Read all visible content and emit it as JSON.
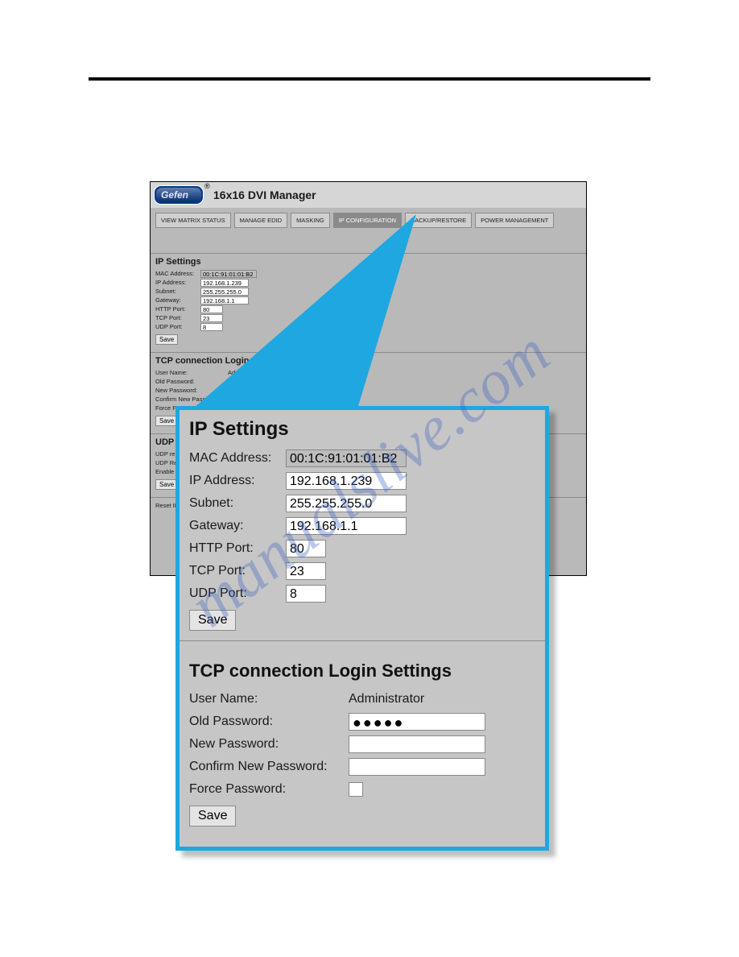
{
  "watermark": "manualslive.com",
  "shot": {
    "brand": "Gefen",
    "title": "16x16 DVI Manager",
    "tabs": [
      "VIEW MATRIX STATUS",
      "MANAGE EDID",
      "MASKING",
      "IP CONFIGURATION",
      "BACKUP/RESTORE",
      "POWER MANAGEMENT"
    ],
    "ip": {
      "heading": "IP Settings",
      "mac_lbl": "MAC Address:",
      "mac_val": "00:1C:91:01:01:B2",
      "ipaddr_lbl": "IP Address:",
      "ipaddr_val": "192.168.1.239",
      "subnet_lbl": "Subnet:",
      "subnet_val": "255.255.255.0",
      "gateway_lbl": "Gateway:",
      "gateway_val": "192.168.1.1",
      "http_lbl": "HTTP Port:",
      "http_val": "80",
      "tcp_lbl": "TCP Port:",
      "tcp_val": "23",
      "udp_lbl": "UDP Port:",
      "udp_val": "8",
      "save": "Save"
    },
    "tcp": {
      "heading": "TCP connection Login Settings",
      "user_lbl": "User Name:",
      "user_val": "Administrator",
      "oldpw_lbl": "Old Password:",
      "oldpw_val": "●●●●●",
      "newpw_lbl": "New Password:",
      "confpw_lbl": "Confirm New Password:",
      "forcepw_lbl": "Force Password:",
      "save": "Save"
    },
    "udp": {
      "heading": "UDP Conn",
      "remoteip_lbl": "UDP remote IP",
      "remotept_lbl": "UDP Remote P",
      "enable_lbl": "Enable UDP ac",
      "save": "Save"
    },
    "reset_lbl": "Reset IP Confi"
  },
  "zoom": {
    "ip": {
      "heading": "IP Settings",
      "mac_lbl": "MAC Address:",
      "mac_val": "00:1C:91:01:01:B2",
      "ipaddr_lbl": "IP Address:",
      "ipaddr_val": "192.168.1.239",
      "subnet_lbl": "Subnet:",
      "subnet_val": "255.255.255.0",
      "gateway_lbl": "Gateway:",
      "gateway_val": "192.168.1.1",
      "http_lbl": "HTTP Port:",
      "http_val": "80",
      "tcp_lbl": "TCP Port:",
      "tcp_val": "23",
      "udp_lbl": "UDP Port:",
      "udp_val": "8",
      "save": "Save"
    },
    "tcp": {
      "heading": "TCP connection Login Settings",
      "user_lbl": "User Name:",
      "user_val": "Administrator",
      "oldpw_lbl": "Old Password:",
      "oldpw_val": "●●●●●",
      "newpw_lbl": "New Password:",
      "confpw_lbl": "Confirm New Password:",
      "forcepw_lbl": "Force Password:",
      "save": "Save"
    }
  }
}
